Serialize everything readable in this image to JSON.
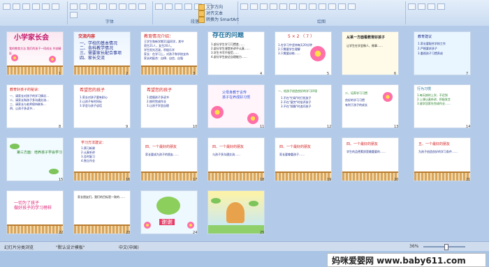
{
  "ribbon": {
    "groups": [
      "字体",
      "段落",
      "绘图"
    ],
    "items": [
      "文字方向",
      "对齐文本",
      "转换为 SmartArt"
    ]
  },
  "slides": [
    {
      "num": "1",
      "title": "小学家长会",
      "subtitle": "我的教育方法 我们的孩子一同成长 共创精彩"
    },
    {
      "num": "2",
      "title": "交流内容",
      "body": "一、学校的基本情况\n二、各科教学情况\n三、需要家长配合事项\n四、家长交流"
    },
    {
      "num": "3",
      "title": "教育情况介绍：",
      "body": "王学生和新学期11届同学，其中\n男生21人，女生20人。\n学生阳光活泼，积极乐学\n家长：在学习上，对孩子和学校支持\n家长的配合：自律、自信、自强"
    },
    {
      "num": "4",
      "title": "存在的问题",
      "body": "1.部分学生学习习惯差……\n2.部分学生课堂听讲不认真……\n3.学生书写不规范……\n4.部分学生缺乏自理能力……"
    },
    {
      "num": "5",
      "title": "5 × 2 （ 7 ）",
      "body": "1.在学习中坚持每天20分钟\n2.只需要学生理解\n3.只需要训练……"
    },
    {
      "num": "6",
      "title": "从某一方面看教育好孩子",
      "body": "让学生在学会做人、做事……"
    },
    {
      "num": "7",
      "title": "教育建议",
      "body": "1.家长要配合学校工作\n2.严格要求孩子\n3.重视孩子习惯养成"
    },
    {
      "num": "8",
      "title": "教育好孩子的秘诀：",
      "body": "一、请家长对孩子的学习情况…\n二、请家长和孩子多沟通交流…\n三、请家长与老师保持联系…\n四、让孩子多读书…"
    },
    {
      "num": "9",
      "title": "希望您的孩子",
      "body": "1.家长对孩子要有耐心\n2.让孩子有时间玩\n3.学会与孩子谈话"
    },
    {
      "num": "10",
      "title": "希望您的孩子",
      "body": "1.提倡孩子多读书\n2.按时完成作业\n3.让孩子学会自理"
    },
    {
      "num": "11",
      "title": "父母身教于言传\n孩子在养成好习惯",
      "body": ""
    },
    {
      "num": "12",
      "title": "一、给孩子创造良好的学习环境",
      "body": "1.不在\"忙碌\"时打扰孩子\n2.不在\"疲劳\"时批评孩子\n3.不在\"烦躁\"时追问孩子"
    },
    {
      "num": "13",
      "title": "二、培养学习习惯",
      "body": "良好的学习习惯\n有利于孩子的成长"
    },
    {
      "num": "14",
      "title": "行为习惯",
      "body": "1.每天按时上学，不迟到\n2.上课认真听讲，积极发言\n3.放学回家先完成作业……"
    },
    {
      "num": "15",
      "title": "第三方面：培养孩子学会学习",
      "body": ""
    },
    {
      "num": "16",
      "title": "学习方法建议：",
      "body": "1.预习新课\n2.认真听讲\n3.及时复习\n4.独立作业"
    },
    {
      "num": "17",
      "title": "四、一个最好的朋友",
      "body": "家长要成为孩子的朋友……"
    },
    {
      "num": "18",
      "title": "四、一个最好的朋友",
      "body": "与孩子多沟通交流……"
    },
    {
      "num": "19",
      "title": "四、一个最好的朋友",
      "body": "家长要尊重孩子……"
    },
    {
      "num": "20",
      "title": "四、一个最好的朋友",
      "body": "学生的品德素质是最重要的……"
    },
    {
      "num": "21",
      "title": "五、一个最好的朋友",
      "body": "为孩子创造良好的学习条件……"
    },
    {
      "num": "22",
      "title": "一切为了孩子\n做好孩子的学习榜样",
      "body": ""
    },
    {
      "num": "23",
      "title": "",
      "body": "家长朋友们，我们的目标是一致的……"
    },
    {
      "num": "24",
      "title": "谢谢",
      "body": ""
    },
    {
      "num": "25",
      "title": "",
      "body": ""
    }
  ],
  "status": {
    "slide_info": "幻灯片分类浏览",
    "theme": "\"默认设计模板\"",
    "lang": "中文(中国)",
    "zoom": "36%"
  },
  "watermark": "妈咪爱婴网 www.baby611.com"
}
